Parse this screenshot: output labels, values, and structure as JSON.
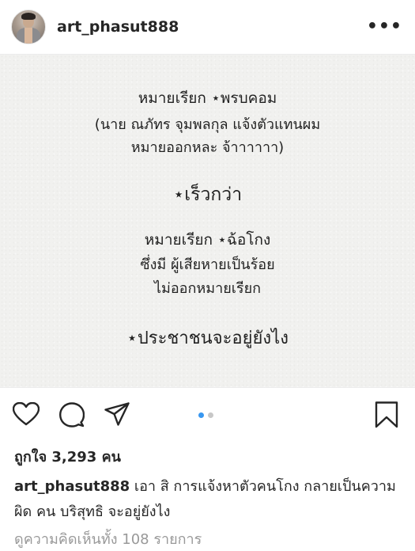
{
  "header": {
    "username": "art_phasut888",
    "more_label": "•••",
    "avatar_icon": "profile-avatar"
  },
  "post": {
    "lines": [
      "หมายเรียก ⋆พรบคอม",
      "(นาย ณภัทร จุมพลกุล แจ้งตัวแทนผม",
      "หมายออกหละ จ้าาาาาา)",
      "⋆เร็วกว่า",
      "หมายเรียก ⋆ฉ้อโกง",
      "ซึ่งมี ผู้เสียหายเป็นร้อย",
      "ไม่ออกหมายเรียก",
      "⋆ประชาชนจะอยู่ยังไง"
    ],
    "carousel": {
      "count": 2,
      "active_index": 0
    }
  },
  "actions": {
    "icons": [
      "heart-icon",
      "comment-icon",
      "share-icon",
      "bookmark-icon"
    ],
    "accent_color": "#3897f0"
  },
  "likes_text": "ถูกใจ 3,293 คน",
  "caption": {
    "username": "art_phasut888",
    "text": "เอา สิ การแจ้งหาตัวคนโกง กลายเป็นความผิด คน บริสุทธิ จะอยู่ยังไง"
  },
  "view_comments": "ดูความคิดเห็นทั้ง 108 รายการ"
}
